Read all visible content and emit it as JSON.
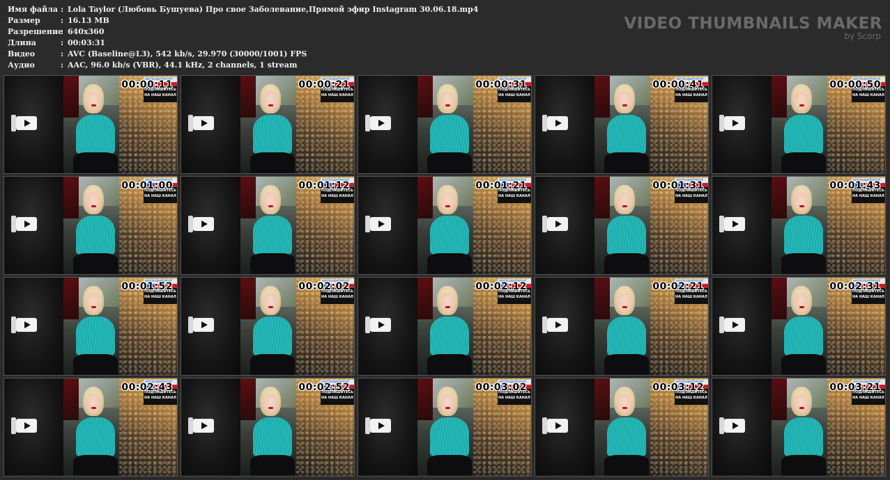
{
  "info": [
    {
      "label": "Имя файла",
      "value": "Lola Taylor (Любовь Бушуева) Про свое Заболевание,Прямой эфир Instagram 30.06.18.mp4"
    },
    {
      "label": "Размер",
      "value": "16.13 MB"
    },
    {
      "label": "Разрешение",
      "value": "640x360"
    },
    {
      "label": "Длина",
      "value": "00:03:31"
    },
    {
      "label": "Видео",
      "value": "AVC (Baseline@L3), 542 kb/s, 29.970 (30000/1001) FPS"
    },
    {
      "label": "Аудио",
      "value": "AAC, 96.0 kb/s (VBR), 44.1 kHz, 2 channels, 1 stream"
    }
  ],
  "separator": ":",
  "brand": {
    "title": "VIDEO THUMBNAILS MAKER",
    "subtitle": "by Scorp"
  },
  "overlay": {
    "handle": "periscopebmod",
    "subscribe_line1": "ПОДПИШИТЕСЬ",
    "subscribe_line2": "НА НАШ КАНАЛ"
  },
  "thumbnails": [
    "00:00:11",
    "00:00:21",
    "00:00:31",
    "00:00:41",
    "00:00:50",
    "00:01:00",
    "00:01:12",
    "00:01:21",
    "00:01:31",
    "00:01:43",
    "00:01:52",
    "00:02:02",
    "00:02:12",
    "00:02:21",
    "00:02:31",
    "00:02:43",
    "00:02:52",
    "00:03:02",
    "00:03:12",
    "00:03:21"
  ]
}
